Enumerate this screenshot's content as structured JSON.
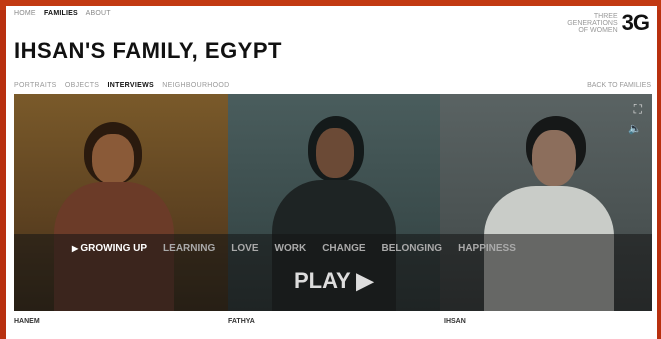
{
  "topnav": {
    "home": "HOME",
    "families": "FAMILIES",
    "about": "ABOUT"
  },
  "logo": {
    "line1": "THREE",
    "line2": "GENERATIONS",
    "line3": "OF WOMEN",
    "mark": "3G"
  },
  "title": "IHSAN'S FAMILY, EGYPT",
  "subnav": {
    "portraits": "PORTRAITS",
    "objects": "OBJECTS",
    "interviews": "INTERVIEWS",
    "neighbourhood": "NEIGHBOURHOOD",
    "back": "BACK TO FAMILIES"
  },
  "chapters": [
    "GROWING UP",
    "LEARNING",
    "LOVE",
    "WORK",
    "CHANGE",
    "BELONGING",
    "HAPPINESS"
  ],
  "play_label": "PLAY ▶",
  "captions": [
    "HANEM",
    "FATHYA",
    "IHSAN"
  ],
  "icons": {
    "fullscreen": "expand-icon",
    "volume": "speaker-icon"
  },
  "colors": {
    "frame": "#b8300f"
  }
}
